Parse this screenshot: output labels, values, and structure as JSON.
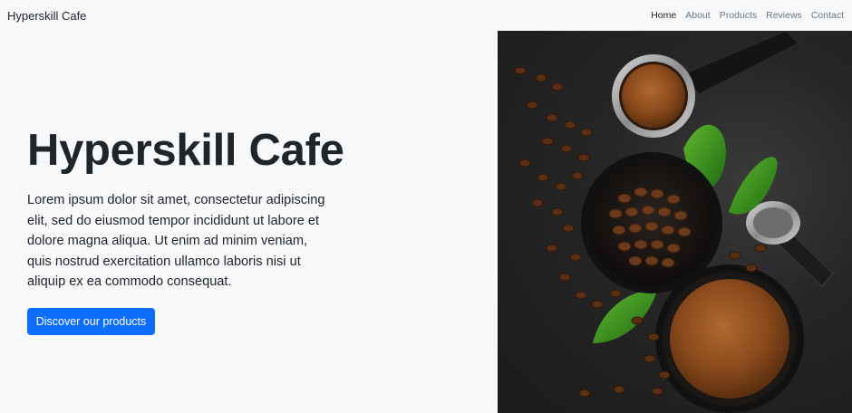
{
  "navbar": {
    "brand": "Hyperskill Cafe",
    "links": [
      {
        "label": "Home",
        "active": true
      },
      {
        "label": "About",
        "active": false
      },
      {
        "label": "Products",
        "active": false
      },
      {
        "label": "Reviews",
        "active": false
      },
      {
        "label": "Contact",
        "active": false
      }
    ]
  },
  "hero": {
    "title": "Hyperskill Cafe",
    "text": "Lorem ipsum dolor sit amet, consectetur adipiscing elit, sed do eiusmod tempor incididunt ut labore et dolore magna aliqua. Ut enim ad minim veniam, quis nostrud exercitation ullamco laboris nisi ut aliquip ex ea commodo consequat.",
    "button_label": "Discover our products",
    "image_alt": "coffee-beans-photo"
  },
  "colors": {
    "primary": "#0d6efd",
    "background": "#f8f9fa",
    "text": "#212529",
    "nav_muted": "#6c757d"
  }
}
